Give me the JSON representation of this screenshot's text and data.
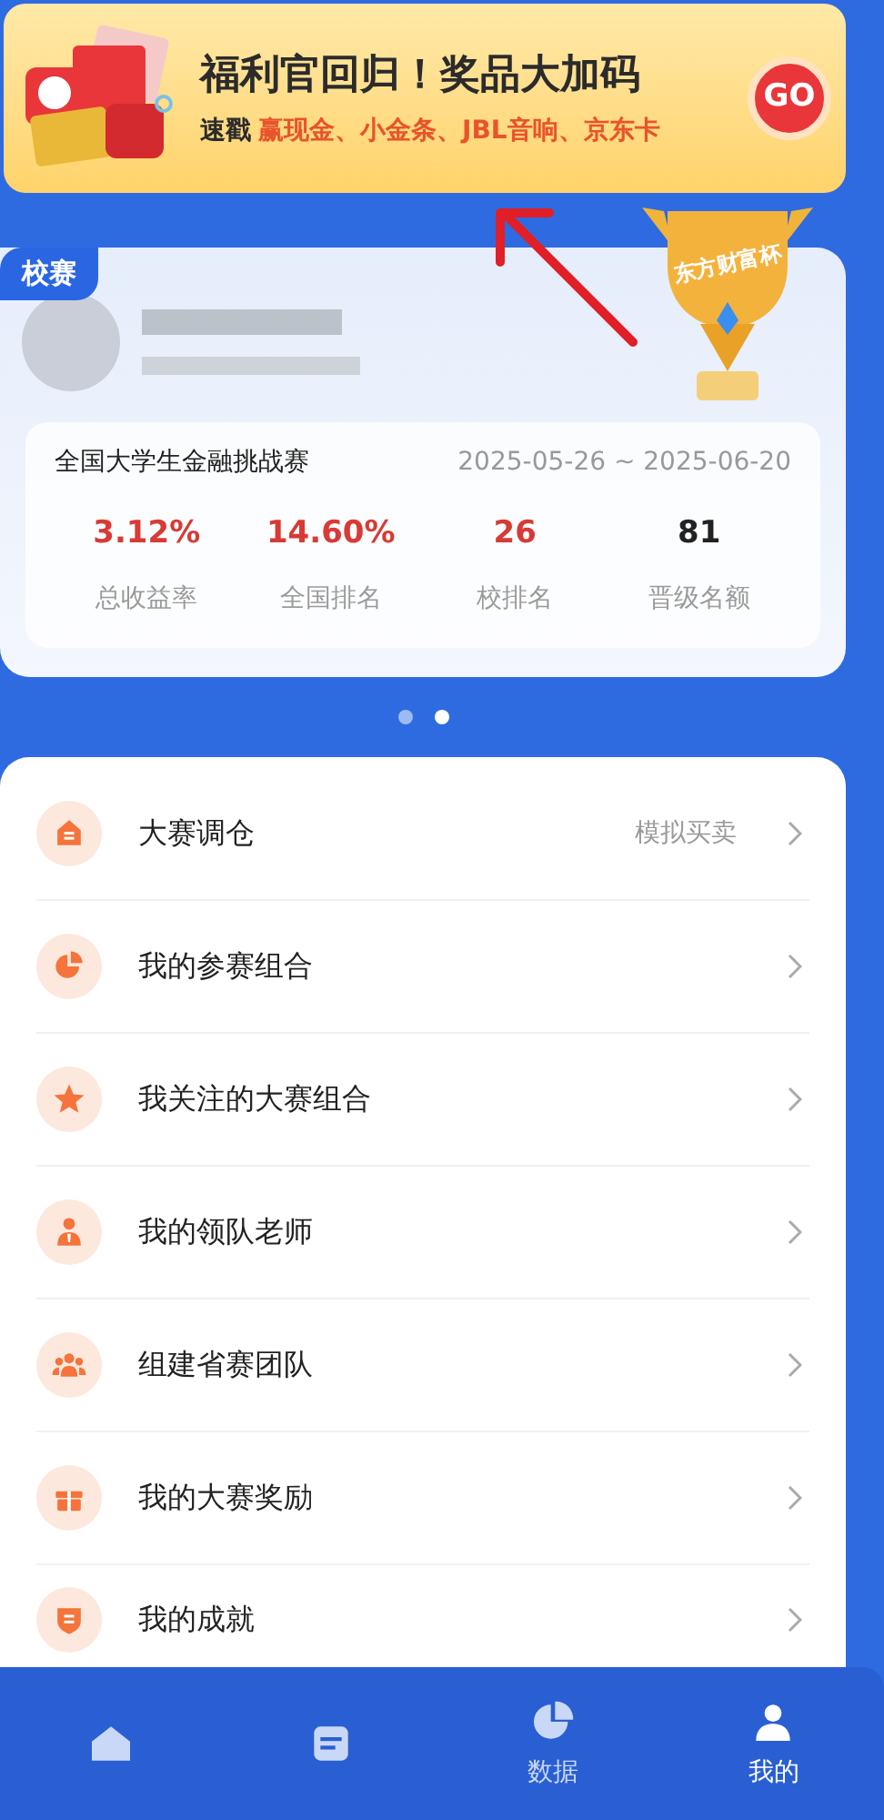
{
  "banner": {
    "title": "福利官回归！奖品大加码",
    "prefix": "速戳",
    "prizes": "赢现金、小金条、JBL音响、京东卡",
    "button": "GO"
  },
  "contest_card": {
    "badge": "校赛",
    "trophy_text": "东方财富杯",
    "name": "全国大学生金融挑战赛",
    "dates": "2025-05-26 ~ 2025-06-20",
    "stats": [
      {
        "value": "3.12%",
        "label": "总收益率",
        "highlight": true
      },
      {
        "value": "14.60%",
        "label": "全国排名",
        "highlight": true
      },
      {
        "value": "26",
        "label": "校排名",
        "highlight": true
      },
      {
        "value": "81",
        "label": "晋级名额",
        "highlight": false
      }
    ]
  },
  "pager": [
    {
      "selected": false
    },
    {
      "selected": true
    }
  ],
  "menu": [
    {
      "kind": "house",
      "label": "大赛调仓",
      "hint": "模拟买卖"
    },
    {
      "kind": "pie",
      "label": "我的参赛组合"
    },
    {
      "kind": "star",
      "label": "我关注的大赛组合"
    },
    {
      "kind": "teacher",
      "label": "我的领队老师"
    },
    {
      "kind": "team",
      "label": "组建省赛团队"
    },
    {
      "kind": "gift",
      "label": "我的大赛奖励"
    },
    {
      "kind": "shield",
      "label": "我的成就"
    }
  ],
  "nav": [
    {
      "kind": "home",
      "selected": false
    },
    {
      "kind": "list",
      "selected": false
    },
    {
      "kind": "pie",
      "label": "数据",
      "selected": false
    },
    {
      "kind": "person",
      "label": "我的",
      "selected": true
    }
  ]
}
